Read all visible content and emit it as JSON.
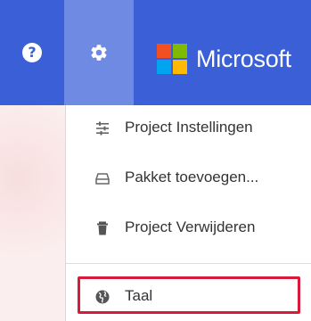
{
  "topbar": {
    "help_icon": "help-circle-icon",
    "help_glyph": "?",
    "settings_icon": "gear-icon",
    "brand_name": "Microsoft",
    "accent_color": "#3a5fd6",
    "active_color": "#6f8ae3"
  },
  "menu": {
    "items": [
      {
        "label": "Project Instellingen",
        "icon": "sliders-icon"
      },
      {
        "label": "Pakket toevoegen...",
        "icon": "package-icon"
      },
      {
        "label": "Project Verwijderen",
        "icon": "trash-icon"
      },
      {
        "label": "Taal",
        "icon": "globe-icon",
        "highlighted": true
      }
    ],
    "highlight_color": "#d81b38"
  },
  "logo_colors": [
    "#f25022",
    "#7fba00",
    "#00a4ef",
    "#ffb900"
  ]
}
